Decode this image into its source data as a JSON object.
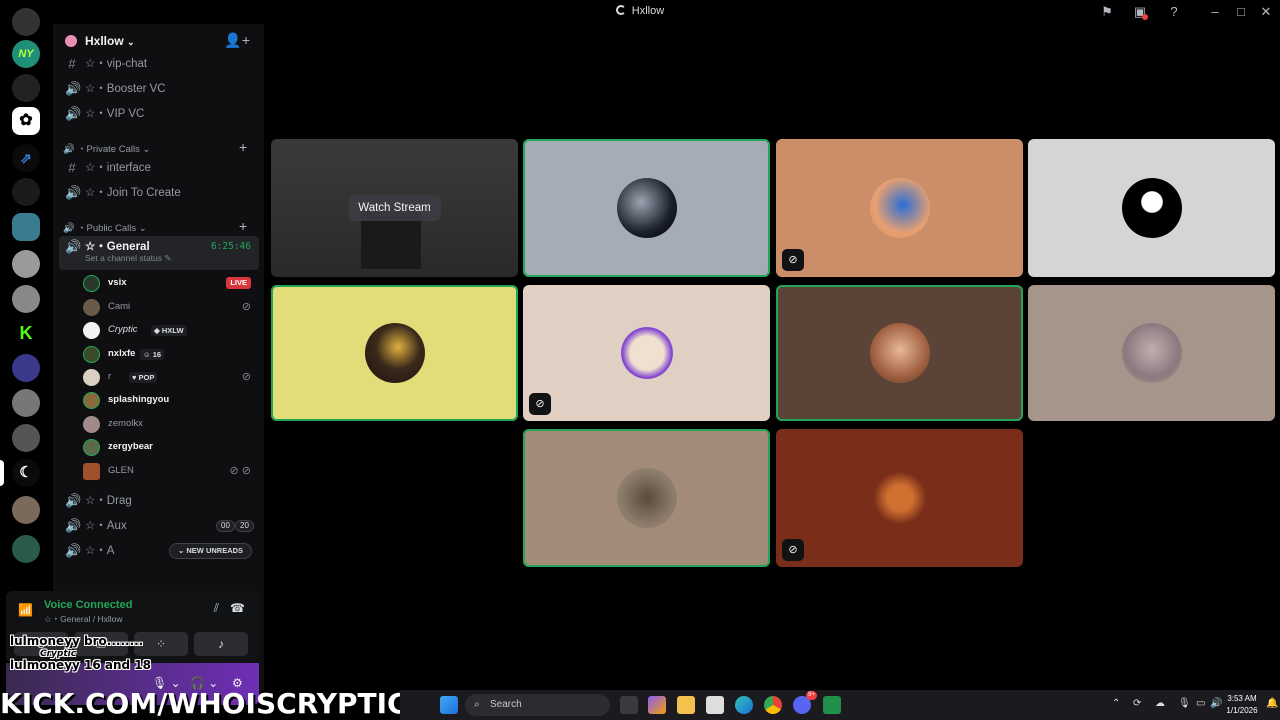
{
  "window": {
    "title": "Hxllow"
  },
  "server": {
    "name": "Hxllow"
  },
  "channels_top": [
    {
      "icon": "#",
      "label": "☆・vip-chat"
    },
    {
      "icon": "🔊",
      "label": "☆・Booster VC"
    },
    {
      "icon": "🔊",
      "label": "☆・VIP VC"
    }
  ],
  "category_private": "Private Calls",
  "channels_private": [
    {
      "icon": "#",
      "label": "☆・interface"
    },
    {
      "icon": "🔊",
      "label": "☆・Join To Create"
    }
  ],
  "category_public": "Public Calls",
  "active_channel": {
    "label": "☆・General",
    "timer": "6:25:46",
    "status": "Set a channel status"
  },
  "voice_users": [
    {
      "name": "vsix",
      "live": "LIVE"
    },
    {
      "name": "Cami"
    },
    {
      "name": "Cryptic",
      "tag": "HXLW"
    },
    {
      "name": "nxlxfe",
      "tag": "16"
    },
    {
      "name": "r",
      "tag": "POP"
    },
    {
      "name": "splashingyou"
    },
    {
      "name": "zemolkx"
    },
    {
      "name": "zergybear"
    },
    {
      "name": "GLEN"
    }
  ],
  "channels_bottom": [
    {
      "icon": "🔊",
      "label": "☆・Drag"
    },
    {
      "icon": "🔊",
      "label": "☆・Aux",
      "badge_a": "00",
      "badge_b": "20"
    },
    {
      "icon": "🔊",
      "label": "☆・A"
    }
  ],
  "new_unreads": "NEW UNREADS",
  "voice_panel": {
    "status": "Voice Connected",
    "location": "☆・General / Hxllow"
  },
  "stream_overlay": {
    "line1": "lulmoneyy  bro........",
    "line2": "lulmoneyy  16 and 18",
    "user": "Cryptic"
  },
  "grid": {
    "watch_stream": "Watch Stream"
  },
  "watermark": "KICK.COM/WHOISCRYPTIC",
  "taskbar": {
    "search_placeholder": "Search",
    "time": "3:53 AM",
    "date": "1/1/2026",
    "discord_badge": "9+"
  }
}
